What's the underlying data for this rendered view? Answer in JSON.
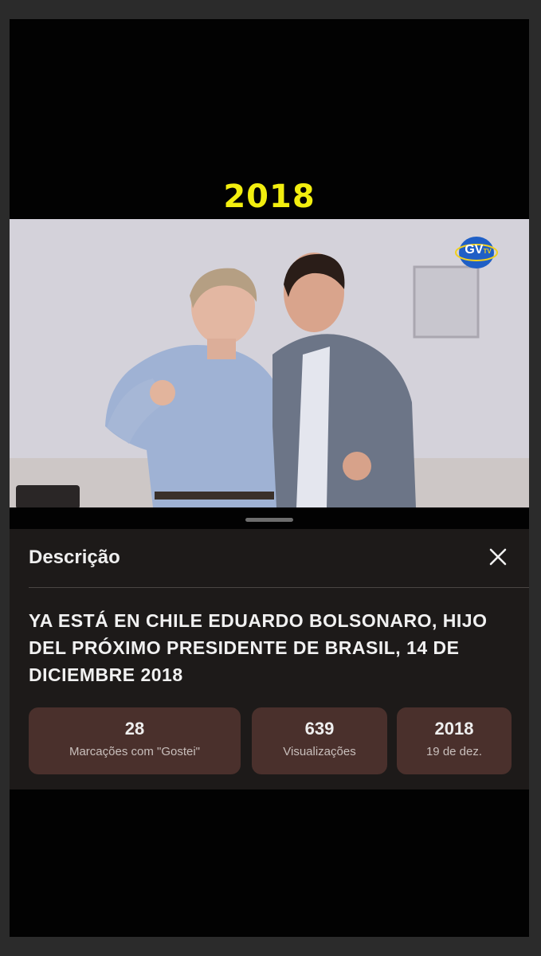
{
  "overlay": {
    "year": "2018"
  },
  "video": {
    "logo_text": "GV",
    "logo_sub": "TV"
  },
  "description_sheet": {
    "title": "Descrição",
    "close_icon": "close-icon",
    "text": "YA ESTÁ EN CHILE EDUARDO BOLSONARO, HIJO DEL PRÓXIMO PRESIDENTE DE BRASIL, 14 DE DICIEMBRE 2018",
    "stats": [
      {
        "value": "28",
        "label": "Marcações com \"Gostei\""
      },
      {
        "value": "639",
        "label": "Visualizações"
      },
      {
        "value": "2018",
        "label": "19 de dez."
      }
    ]
  },
  "colors": {
    "year_caption": "#f2ee0f",
    "sheet_bg": "#1d1a19",
    "stat_bg": "#4a302c"
  }
}
